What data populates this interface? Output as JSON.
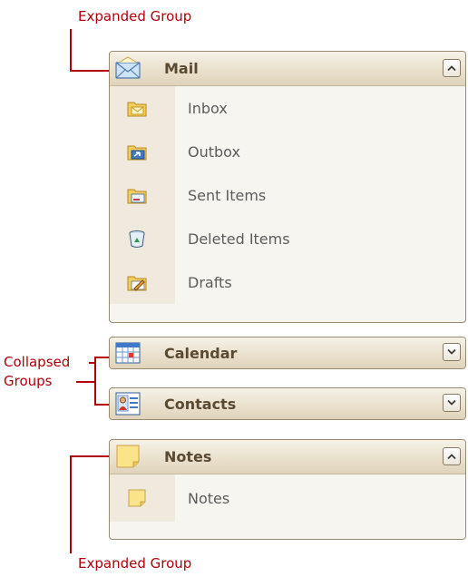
{
  "annotations": {
    "expanded_top": "Expanded Group",
    "collapsed_line1": "Collapsed",
    "collapsed_line2": "Groups",
    "expanded_bottom": "Expanded Group"
  },
  "groups": [
    {
      "title": "Mail",
      "state": "expanded",
      "icon": "mail-icon",
      "items": [
        {
          "label": "Inbox",
          "icon": "inbox-icon"
        },
        {
          "label": "Outbox",
          "icon": "outbox-icon"
        },
        {
          "label": "Sent Items",
          "icon": "sent-items-icon"
        },
        {
          "label": "Deleted Items",
          "icon": "deleted-items-icon"
        },
        {
          "label": "Drafts",
          "icon": "drafts-icon"
        }
      ]
    },
    {
      "title": "Calendar",
      "state": "collapsed",
      "icon": "calendar-icon"
    },
    {
      "title": "Contacts",
      "state": "collapsed",
      "icon": "contacts-icon"
    },
    {
      "title": "Notes",
      "state": "expanded",
      "icon": "notes-icon",
      "items": [
        {
          "label": "Notes",
          "icon": "note-icon"
        }
      ]
    }
  ],
  "colors": {
    "annotation": "#b0000a",
    "header_top": "#f6f2e8",
    "header_bottom": "#dfd3bb",
    "panel_border": "#9b8a72",
    "item_text": "#5c5c5c"
  }
}
